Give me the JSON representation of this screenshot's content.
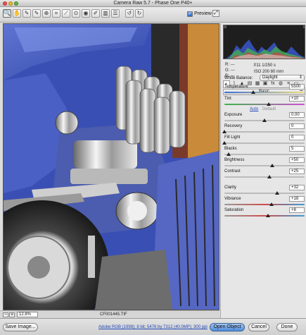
{
  "window": {
    "title": "Camera Raw 5.7  -  Phase One P40+"
  },
  "toolbar": {
    "tools": [
      {
        "icon": "zoom-icon",
        "glyph": "🔍"
      },
      {
        "icon": "hand-icon",
        "glyph": "✋"
      },
      {
        "icon": "white-balance-icon",
        "glyph": "✎"
      },
      {
        "icon": "color-sampler-icon",
        "glyph": "✎"
      },
      {
        "icon": "targeted-adjustment-icon",
        "glyph": "⊕"
      },
      {
        "icon": "crop-icon",
        "glyph": "⌗"
      },
      {
        "icon": "straighten-icon",
        "glyph": "⟋"
      },
      {
        "icon": "spot-removal-icon",
        "glyph": "⊙"
      },
      {
        "icon": "red-eye-icon",
        "glyph": "◉"
      },
      {
        "icon": "adjustment-brush-icon",
        "glyph": "✐"
      },
      {
        "icon": "graduated-filter-icon",
        "glyph": "▥"
      },
      {
        "icon": "preferences-icon",
        "glyph": "☰"
      },
      {
        "icon": "rotate-ccw-icon",
        "glyph": "↺"
      },
      {
        "icon": "rotate-cw-icon",
        "glyph": "↻"
      }
    ],
    "preview_label": "Preview",
    "preview_checked": "✓"
  },
  "readout": {
    "r": "R:  ---",
    "g": "G:  ---",
    "b": "B:  ---",
    "exif_line1": "f/11    1/250 s",
    "exif_line2": "ISO 200    80 mm"
  },
  "panel": {
    "section_title": "Basic",
    "white_balance_label": "White Balance:",
    "white_balance_value": "Daylight",
    "auto_label": "Auto",
    "default_label": "Default",
    "sliders": [
      {
        "label": "Temperature",
        "value": "5500",
        "pos": 0.36
      },
      {
        "label": "Tint",
        "value": "+10",
        "pos": 0.55
      },
      {
        "label": "Exposure",
        "value": "0.00",
        "pos": 0.5
      },
      {
        "label": "Recovery",
        "value": "0",
        "pos": 0.0
      },
      {
        "label": "Fill Light",
        "value": "0",
        "pos": 0.0
      },
      {
        "label": "Blacks",
        "value": "5",
        "pos": 0.05
      },
      {
        "label": "Brightness",
        "value": "+50",
        "pos": 0.6
      },
      {
        "label": "Contrast",
        "value": "+25",
        "pos": 0.56
      },
      {
        "label": "Clarity",
        "value": "+32",
        "pos": 0.66
      },
      {
        "label": "Vibrance",
        "value": "+18",
        "pos": 0.59
      },
      {
        "label": "Saturation",
        "value": "+8",
        "pos": 0.54
      }
    ]
  },
  "status": {
    "minus": "−",
    "plus": "+",
    "zoom": "12.8%",
    "filename": "CF001445.TIF"
  },
  "bottom": {
    "save_label": "Save Image...",
    "workflow_link": "Adobe RGB (1998); 8 bit; 5476 by 7312 (40.0MP); 300 ppi",
    "open_label": "Open Object",
    "cancel_label": "Cancel",
    "done_label": "Done"
  }
}
